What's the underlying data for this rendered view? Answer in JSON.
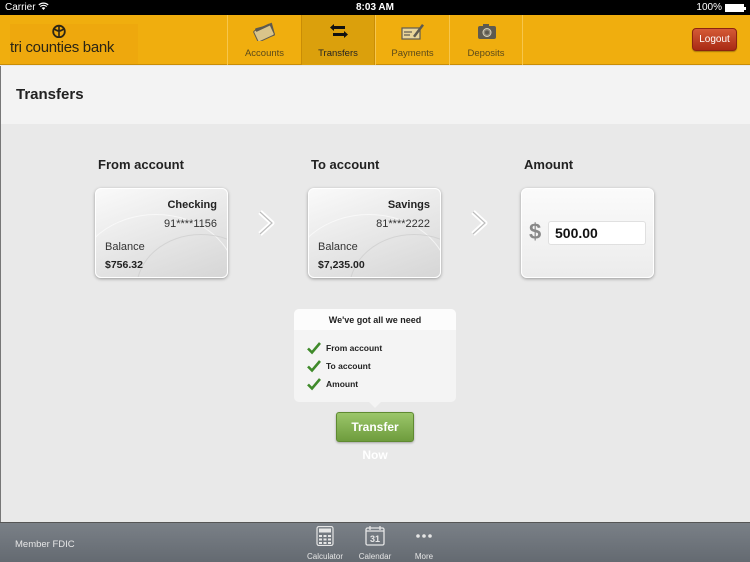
{
  "status_bar": {
    "carrier": "Carrier",
    "wifi_icon": "wifi-icon",
    "time": "8:03 AM",
    "battery": "100%"
  },
  "header": {
    "brand": "tri counties bank",
    "brand_color": "#f0ae0e",
    "tabs": [
      {
        "label": "Accounts",
        "icon": "credit-card-icon",
        "active": false
      },
      {
        "label": "Transfers",
        "icon": "transfer-arrows-icon",
        "active": true
      },
      {
        "label": "Payments",
        "icon": "check-pen-icon",
        "active": false
      },
      {
        "label": "Deposits",
        "icon": "camera-icon",
        "active": false
      }
    ],
    "logout_label": "Logout"
  },
  "page": {
    "title": "Transfers"
  },
  "transfer": {
    "from_label": "From account",
    "to_label": "To account",
    "amount_label": "Amount",
    "from_account": {
      "type": "Checking",
      "number": "91****1156",
      "balance_label": "Balance",
      "balance": "$756.32"
    },
    "to_account": {
      "type": "Savings",
      "number": "81****2222",
      "balance_label": "Balance",
      "balance": "$7,235.00"
    },
    "currency_symbol": "$",
    "amount_value": "500.00"
  },
  "checklist": {
    "heading": "We've got all we need",
    "items": [
      {
        "label": "From account",
        "checked": true
      },
      {
        "label": "To account",
        "checked": true
      },
      {
        "label": "Amount",
        "checked": true
      }
    ],
    "check_color": "#3f8a2a"
  },
  "transfer_button_label": "Transfer Now",
  "footer": {
    "fdic": "Member FDIC",
    "tools": [
      {
        "label": "Calculator",
        "icon": "calculator-icon"
      },
      {
        "label": "Calendar",
        "icon": "calendar-icon",
        "day": "31"
      },
      {
        "label": "More",
        "icon": "more-dots-icon"
      }
    ]
  }
}
